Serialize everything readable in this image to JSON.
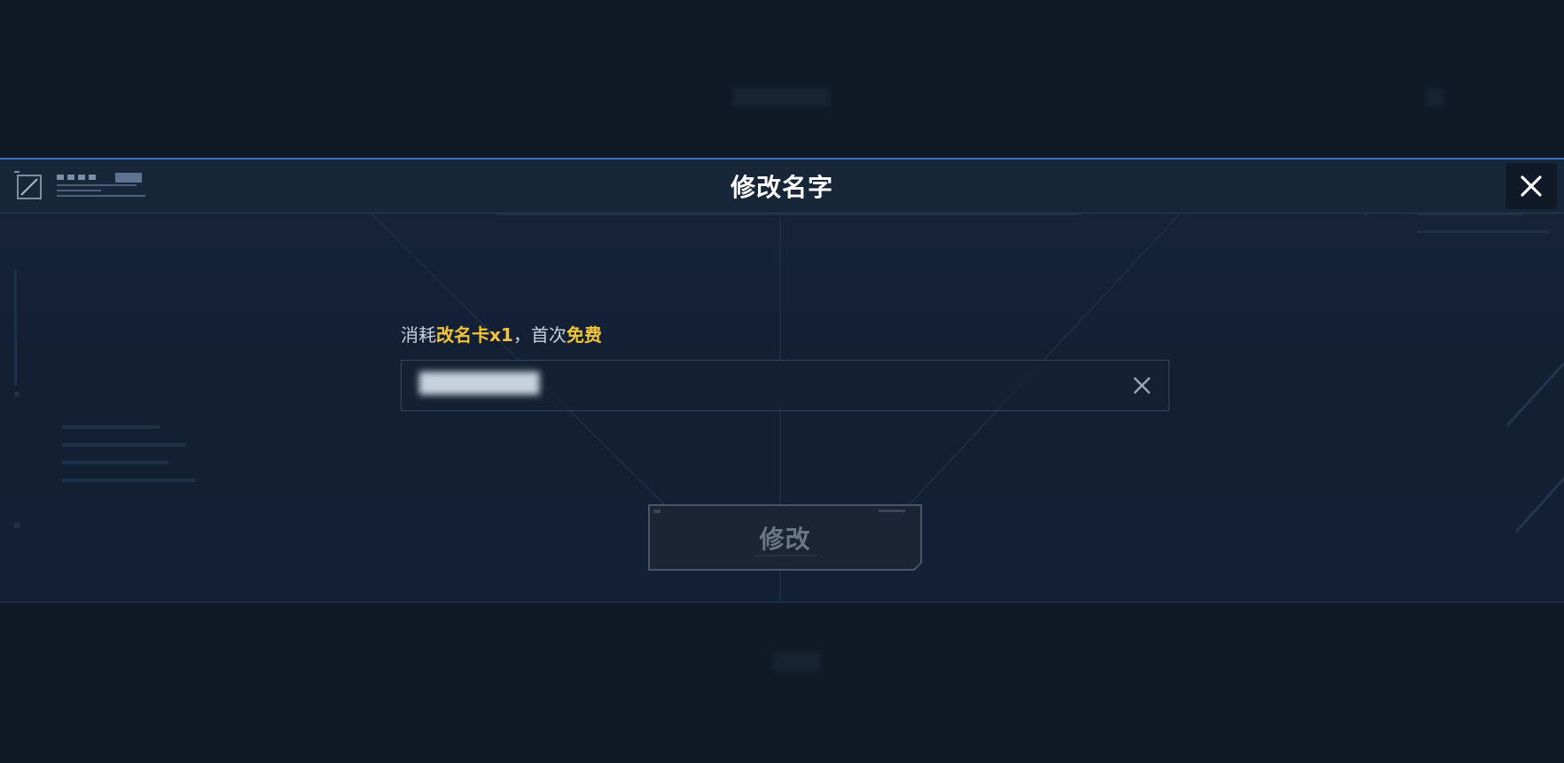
{
  "dialog": {
    "title": "修改名字"
  },
  "notice": {
    "prefix": "消耗",
    "item": "改名卡x1",
    "separator": "，首次",
    "free": "免费"
  },
  "name_input": {
    "value": "████████"
  },
  "submit": {
    "label": "修改"
  },
  "icons": {
    "close": "close-icon",
    "clear": "clear-icon",
    "logo": "emblem-logo"
  },
  "colors": {
    "accent_line": "#3f6fb6",
    "highlight": "#f3c43a",
    "disabled_text": "#6b7684"
  }
}
